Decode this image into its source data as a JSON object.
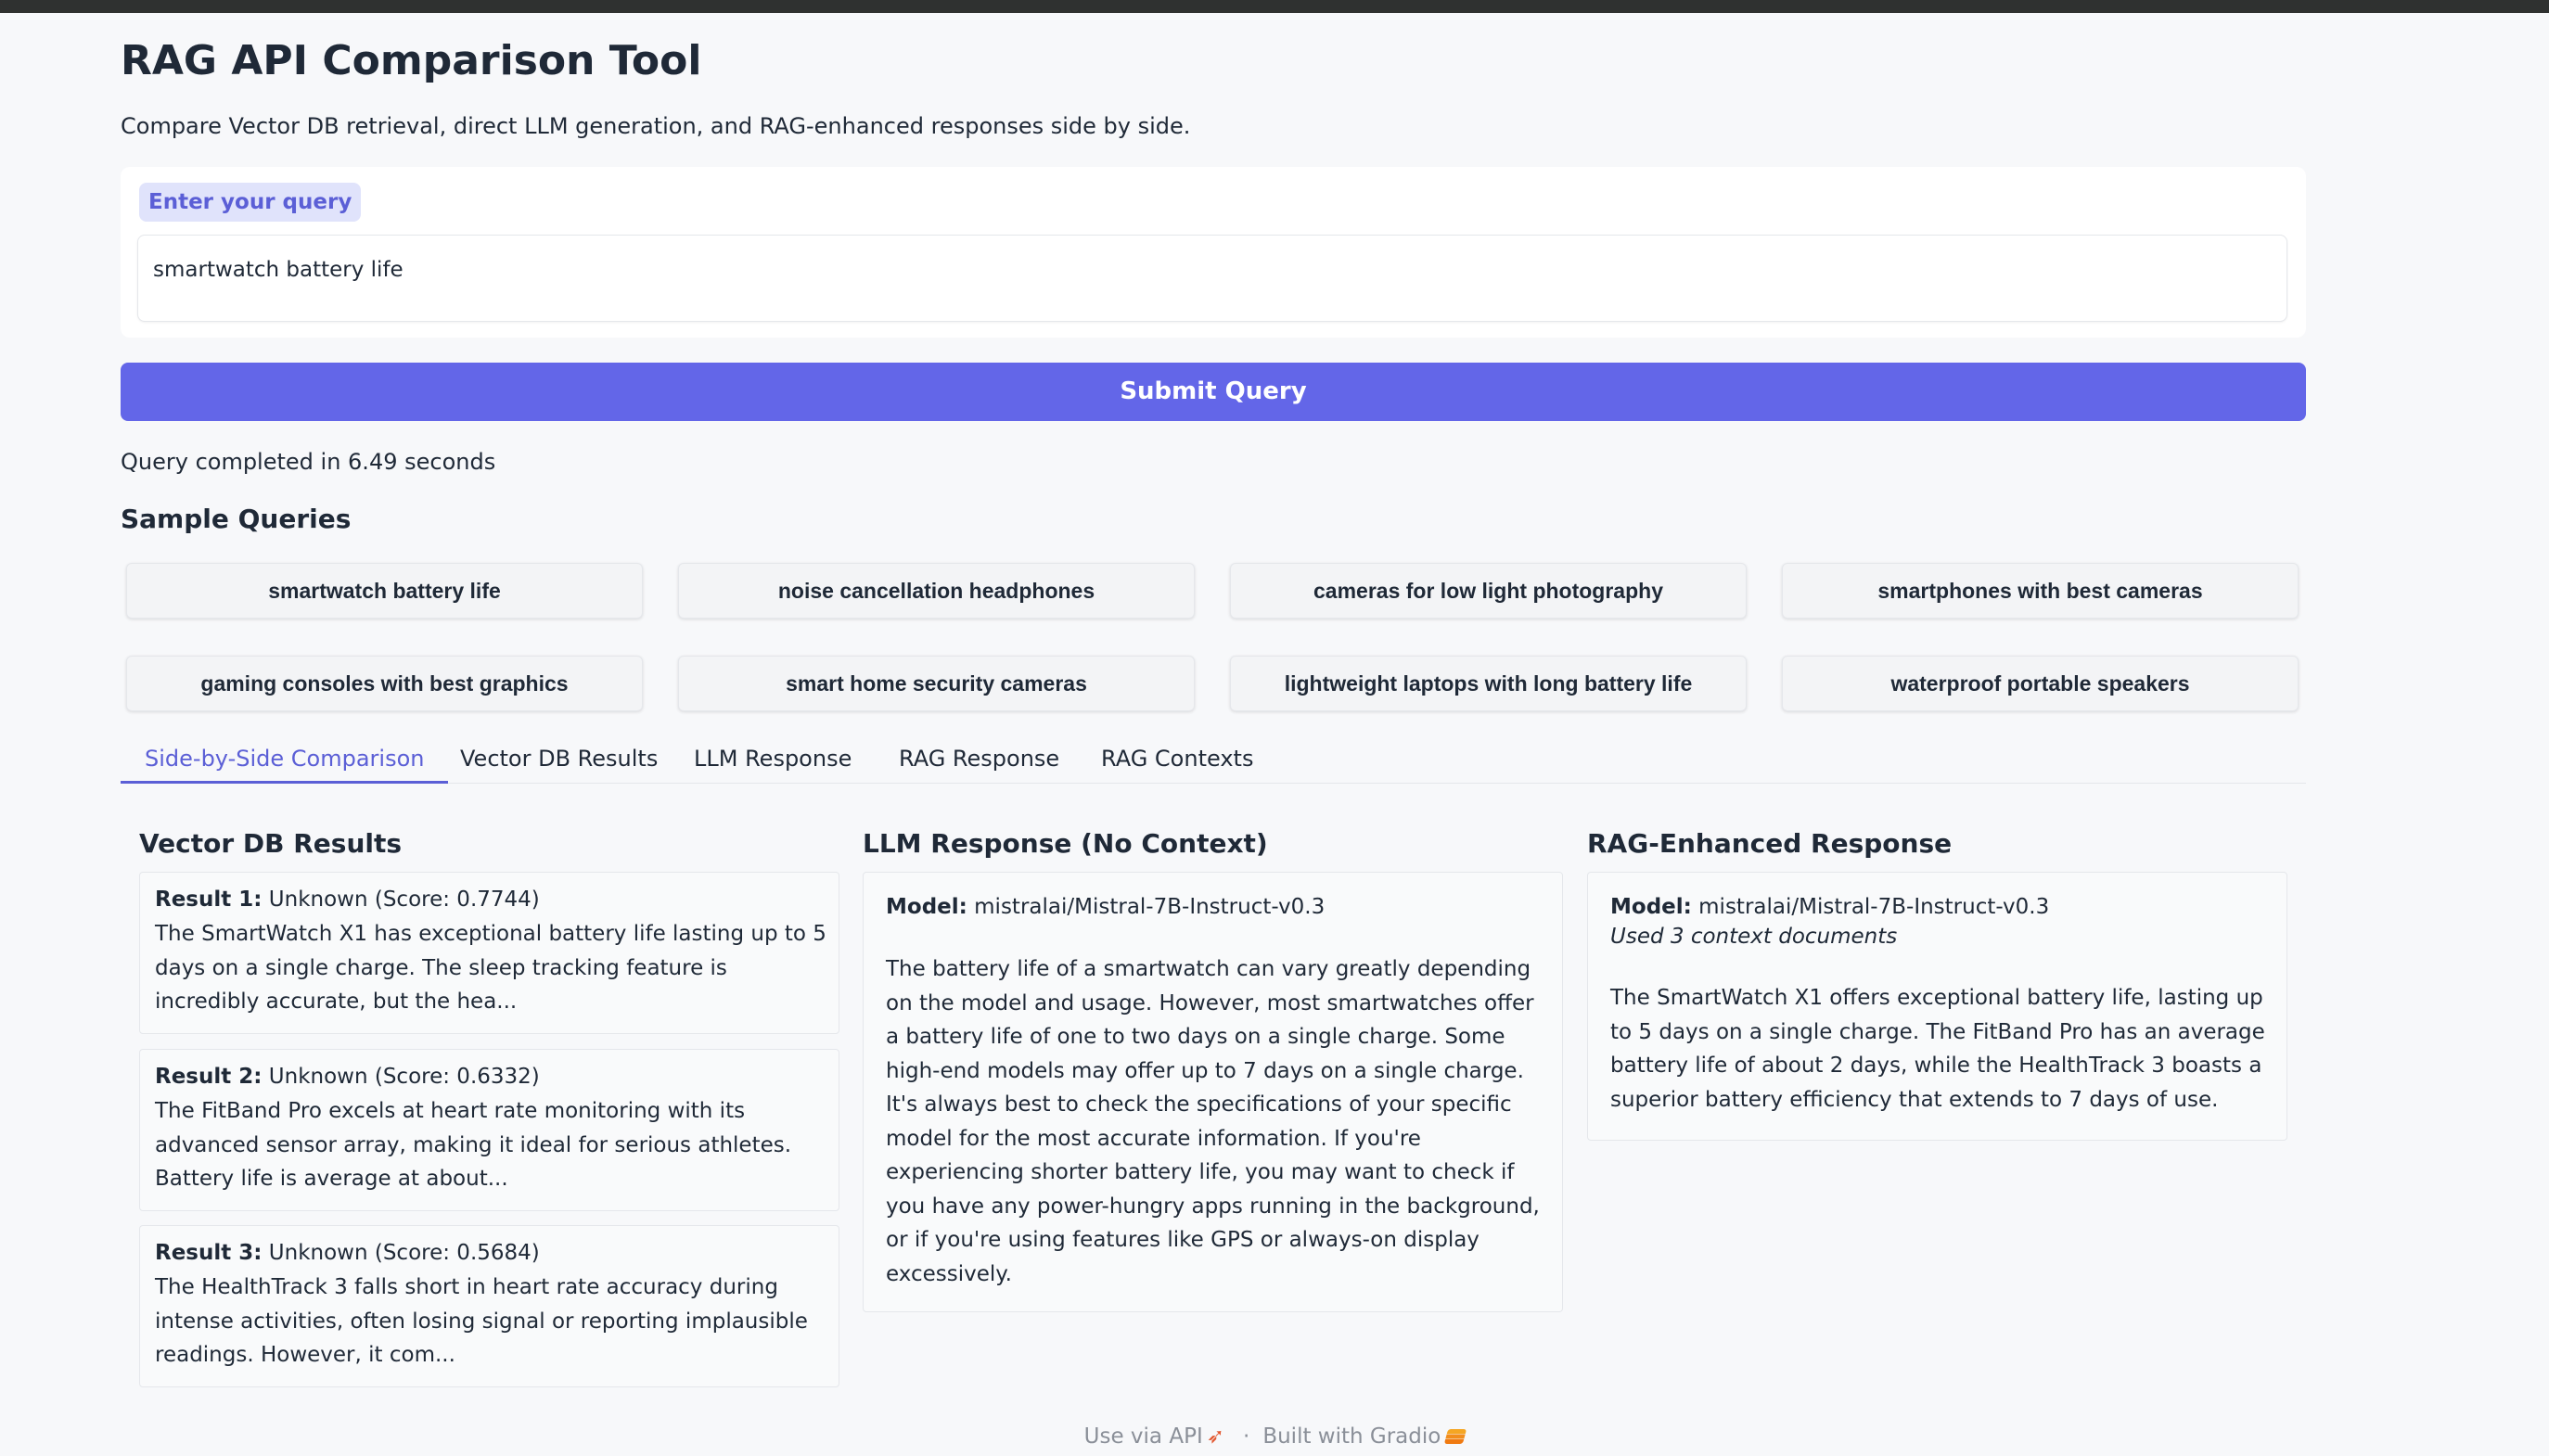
{
  "app": {
    "title": "RAG API Comparison Tool",
    "subtitle": "Compare Vector DB retrieval, direct LLM generation, and RAG-enhanced responses side by side."
  },
  "query": {
    "label": "Enter your query",
    "value": "smartwatch battery life"
  },
  "submit_label": "Submit Query",
  "status": "Query completed in 6.49 seconds",
  "samples": {
    "title": "Sample Queries",
    "items": [
      "smartwatch battery life",
      "noise cancellation headphones",
      "cameras for low light photography",
      "smartphones with best cameras",
      "gaming consoles with best graphics",
      "smart home security cameras",
      "lightweight laptops with long battery life",
      "waterproof portable speakers"
    ]
  },
  "tabs": [
    "Side-by-Side Comparison",
    "Vector DB Results",
    "LLM Response",
    "RAG Response",
    "RAG Contexts"
  ],
  "vector_db": {
    "title": "Vector DB Results",
    "results": [
      {
        "label": "Result 1:",
        "meta": "Unknown (Score: 0.7744)",
        "text": "The SmartWatch X1 has exceptional battery life lasting up to 5 days on a single charge. The sleep tracking feature is incredibly accurate, but the hea..."
      },
      {
        "label": "Result 2:",
        "meta": "Unknown (Score: 0.6332)",
        "text": "The FitBand Pro excels at heart rate monitoring with its advanced sensor array, making it ideal for serious athletes. Battery life is average at about..."
      },
      {
        "label": "Result 3:",
        "meta": "Unknown (Score: 0.5684)",
        "text": "The HealthTrack 3 falls short in heart rate accuracy during intense activities, often losing signal or reporting implausible readings. However, it com..."
      }
    ]
  },
  "llm": {
    "title": "LLM Response (No Context)",
    "model_label": "Model:",
    "model": "mistralai/Mistral-7B-Instruct-v0.3",
    "text": "The battery life of a smartwatch can vary greatly depending on the model and usage. However, most smartwatches offer a battery life of one to two days on a single charge. Some high-end models may offer up to 7 days on a single charge. It's always best to check the specifications of your specific model for the most accurate information. If you're experiencing shorter battery life, you may want to check if you have any power-hungry apps running in the background, or if you're using features like GPS or always-on display excessively."
  },
  "rag": {
    "title": "RAG-Enhanced Response",
    "model_label": "Model:",
    "model": "mistralai/Mistral-7B-Instruct-v0.3",
    "context_note": "Used 3 context documents",
    "text": "The SmartWatch X1 offers exceptional battery life, lasting up to 5 days on a single charge. The FitBand Pro has an average battery life of about 2 days, while the HealthTrack 3 boasts a superior battery efficiency that extends to 7 days of use."
  },
  "footer": {
    "api": "Use via API",
    "separator": "·",
    "built": "Built with Gradio",
    "rocket_icon": "rocket-icon",
    "gradio_icon": "gradio-logo-icon"
  }
}
